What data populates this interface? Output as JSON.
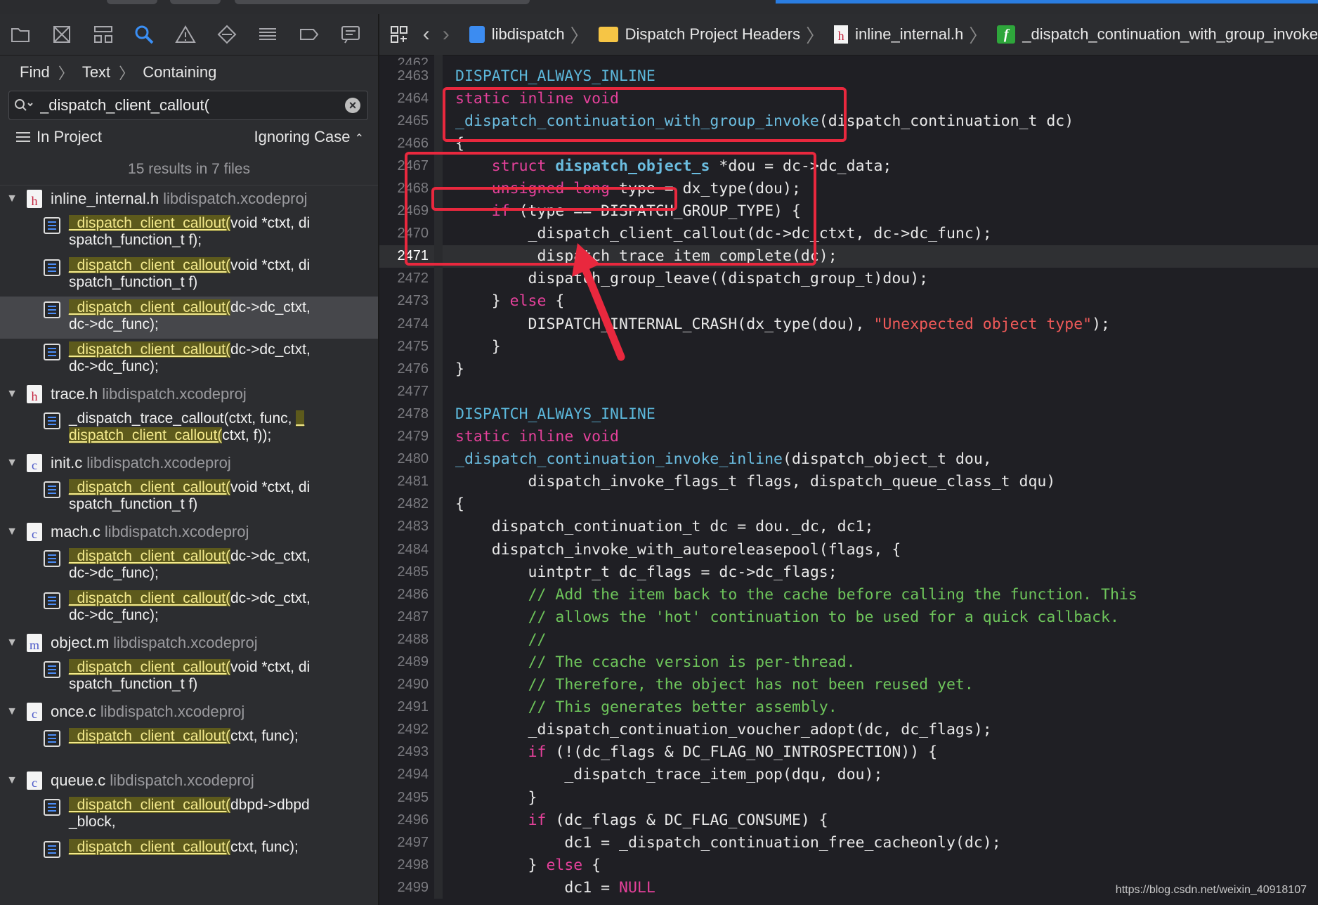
{
  "navigator": {
    "breadcrumb": [
      "Find",
      "Text",
      "Containing"
    ],
    "search": {
      "value": "_dispatch_client_callout(",
      "placeholder": ""
    },
    "scope": "In Project",
    "case_option": "Ignoring Case",
    "results_summary": "15 results in 7 files",
    "files": [
      {
        "name": "inline_internal.h",
        "project": "libdispatch.xcodeproj",
        "type": "h",
        "matches": [
          {
            "hl": "_dispatch_client_callout(",
            "rest": "void *ctxt, dispatch_function_t f);",
            "pre": ""
          },
          {
            "hl": "_dispatch_client_callout(",
            "rest": "void *ctxt, dispatch_function_t f)",
            "pre": ""
          },
          {
            "hl": "_dispatch_client_callout(",
            "rest": "dc->dc_ctxt, dc->dc_func);",
            "pre": ""
          },
          {
            "hl": "_dispatch_client_callout(",
            "rest": "dc->dc_ctxt, dc->dc_func);",
            "pre": ""
          }
        ]
      },
      {
        "name": "trace.h",
        "project": "libdispatch.xcodeproj",
        "type": "h",
        "matches": [
          {
            "pre": "_dispatch_trace_callout(ctxt, func, ",
            "hl": "_dispatch_client_callout(",
            "rest": "ctxt, f));"
          }
        ]
      },
      {
        "name": "init.c",
        "project": "libdispatch.xcodeproj",
        "type": "c",
        "matches": [
          {
            "hl": "_dispatch_client_callout(",
            "rest": "void *ctxt, dispatch_function_t f)",
            "pre": ""
          }
        ]
      },
      {
        "name": "mach.c",
        "project": "libdispatch.xcodeproj",
        "type": "c",
        "matches": [
          {
            "hl": "_dispatch_client_callout(",
            "rest": "dc->dc_ctxt, dc->dc_func);",
            "pre": ""
          },
          {
            "hl": "_dispatch_client_callout(",
            "rest": "dc->dc_ctxt, dc->dc_func);",
            "pre": ""
          }
        ]
      },
      {
        "name": "object.m",
        "project": "libdispatch.xcodeproj",
        "type": "m",
        "matches": [
          {
            "hl": "_dispatch_client_callout(",
            "rest": "void *ctxt, dispatch_function_t f)",
            "pre": ""
          }
        ]
      },
      {
        "name": "once.c",
        "project": "libdispatch.xcodeproj",
        "type": "c",
        "matches": [
          {
            "hl": "_dispatch_client_callout(",
            "rest": "ctxt, func);",
            "pre": ""
          }
        ]
      },
      {
        "name": "queue.c",
        "project": "libdispatch.xcodeproj",
        "type": "c",
        "matches": [
          {
            "hl": "_dispatch_client_callout(",
            "rest": "dbpd->dbpd_block,",
            "pre": ""
          },
          {
            "hl": "_dispatch_client_callout(",
            "rest": "ctxt, func);",
            "pre": ""
          }
        ]
      }
    ]
  },
  "jumpbar": {
    "crumbs": [
      "libdispatch",
      "Dispatch Project Headers",
      "inline_internal.h",
      "_dispatch_continuation_with_group_invoke"
    ]
  },
  "editor": {
    "current_line": 2471,
    "first_partial_line": "2462",
    "lines": [
      {
        "n": 2463,
        "segs": [
          [
            "mac",
            "DISPATCH_ALWAYS_INLINE"
          ]
        ]
      },
      {
        "n": 2464,
        "segs": [
          [
            "kw",
            "static inline void"
          ]
        ]
      },
      {
        "n": 2465,
        "segs": [
          [
            "fn",
            "_dispatch_continuation_with_group_invoke"
          ],
          [
            "",
            "(dispatch_continuation_t dc)"
          ]
        ]
      },
      {
        "n": 2466,
        "segs": [
          [
            "",
            "{"
          ]
        ]
      },
      {
        "n": 2467,
        "segs": [
          [
            "",
            "    "
          ],
          [
            "kw",
            "struct"
          ],
          [
            "",
            " "
          ],
          [
            "ty",
            "dispatch_object_s"
          ],
          [
            "",
            " *dou = dc->dc_data;"
          ]
        ]
      },
      {
        "n": 2468,
        "segs": [
          [
            "",
            "    "
          ],
          [
            "kw",
            "unsigned long"
          ],
          [
            "",
            " type = dx_type(dou);"
          ]
        ]
      },
      {
        "n": 2469,
        "segs": [
          [
            "",
            "    "
          ],
          [
            "kw",
            "if"
          ],
          [
            "",
            " (type == DISPATCH_GROUP_TYPE) {"
          ]
        ]
      },
      {
        "n": 2470,
        "segs": [
          [
            "",
            "        _dispatch_client_callout(dc->dc_ctxt, dc->dc_func);"
          ]
        ]
      },
      {
        "n": 2471,
        "segs": [
          [
            "",
            "        _dispatch_trace_item_complete(dc);"
          ]
        ]
      },
      {
        "n": 2472,
        "segs": [
          [
            "",
            "        dispatch_group_leave((dispatch_group_t)dou);"
          ]
        ]
      },
      {
        "n": 2473,
        "segs": [
          [
            "",
            "    } "
          ],
          [
            "kw",
            "else"
          ],
          [
            "",
            " {"
          ]
        ]
      },
      {
        "n": 2474,
        "segs": [
          [
            "",
            "        DISPATCH_INTERNAL_CRASH(dx_type(dou), "
          ],
          [
            "st",
            "\"Unexpected object type\""
          ],
          [
            "",
            ");"
          ]
        ]
      },
      {
        "n": 2475,
        "segs": [
          [
            "",
            "    }"
          ]
        ]
      },
      {
        "n": 2476,
        "segs": [
          [
            "",
            "}"
          ]
        ]
      },
      {
        "n": 2477,
        "segs": [
          [
            "",
            ""
          ]
        ]
      },
      {
        "n": 2478,
        "segs": [
          [
            "mac",
            "DISPATCH_ALWAYS_INLINE"
          ]
        ]
      },
      {
        "n": 2479,
        "segs": [
          [
            "kw",
            "static inline void"
          ]
        ]
      },
      {
        "n": 2480,
        "segs": [
          [
            "fn",
            "_dispatch_continuation_invoke_inline"
          ],
          [
            "",
            "(dispatch_object_t dou,"
          ]
        ]
      },
      {
        "n": 2481,
        "segs": [
          [
            "",
            "        dispatch_invoke_flags_t flags, dispatch_queue_class_t dqu)"
          ]
        ]
      },
      {
        "n": 2482,
        "segs": [
          [
            "",
            "{"
          ]
        ]
      },
      {
        "n": 2483,
        "segs": [
          [
            "",
            "    dispatch_continuation_t dc = dou._dc, dc1;"
          ]
        ]
      },
      {
        "n": 2484,
        "segs": [
          [
            "",
            "    dispatch_invoke_with_autoreleasepool(flags, {"
          ]
        ]
      },
      {
        "n": 2485,
        "segs": [
          [
            "",
            "        uintptr_t dc_flags = dc->dc_flags;"
          ]
        ]
      },
      {
        "n": 2486,
        "segs": [
          [
            "",
            "        "
          ],
          [
            "cm",
            "// Add the item back to the cache before calling the function. This"
          ]
        ]
      },
      {
        "n": 2487,
        "segs": [
          [
            "",
            "        "
          ],
          [
            "cm",
            "// allows the 'hot' continuation to be used for a quick callback."
          ]
        ]
      },
      {
        "n": 2488,
        "segs": [
          [
            "",
            "        "
          ],
          [
            "cm",
            "//"
          ]
        ]
      },
      {
        "n": 2489,
        "segs": [
          [
            "",
            "        "
          ],
          [
            "cm",
            "// The ccache version is per-thread."
          ]
        ]
      },
      {
        "n": 2490,
        "segs": [
          [
            "",
            "        "
          ],
          [
            "cm",
            "// Therefore, the object has not been reused yet."
          ]
        ]
      },
      {
        "n": 2491,
        "segs": [
          [
            "",
            "        "
          ],
          [
            "cm",
            "// This generates better assembly."
          ]
        ]
      },
      {
        "n": 2492,
        "segs": [
          [
            "",
            "        _dispatch_continuation_voucher_adopt(dc, dc_flags);"
          ]
        ]
      },
      {
        "n": 2493,
        "segs": [
          [
            "",
            "        "
          ],
          [
            "kw",
            "if"
          ],
          [
            "",
            " (!(dc_flags & DC_FLAG_NO_INTROSPECTION)) {"
          ]
        ]
      },
      {
        "n": 2494,
        "segs": [
          [
            "",
            "            _dispatch_trace_item_pop(dqu, dou);"
          ]
        ]
      },
      {
        "n": 2495,
        "segs": [
          [
            "",
            "        }"
          ]
        ]
      },
      {
        "n": 2496,
        "segs": [
          [
            "",
            "        "
          ],
          [
            "kw",
            "if"
          ],
          [
            "",
            " (dc_flags & DC_FLAG_CONSUME) {"
          ]
        ]
      },
      {
        "n": 2497,
        "segs": [
          [
            "",
            "            dc1 = _dispatch_continuation_free_cacheonly(dc);"
          ]
        ]
      },
      {
        "n": 2498,
        "segs": [
          [
            "",
            "        } "
          ],
          [
            "kw",
            "else"
          ],
          [
            "",
            " {"
          ]
        ]
      },
      {
        "n": 2499,
        "segs": [
          [
            "",
            "            dc1 = "
          ],
          [
            "nul",
            "NULL"
          ],
          [
            ";"
          ]
        ]
      }
    ]
  },
  "watermark": "https://blog.csdn.net/weixin_40918107",
  "colors": {
    "annotation_red": "#e9283e",
    "accent_blue": "#2a7de1",
    "match_highlight": "#5d5a1c"
  }
}
